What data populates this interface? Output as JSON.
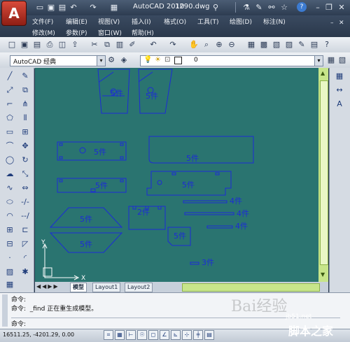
{
  "titlebar": {
    "title": "AutoCAD 2010",
    "file": "1290.dwg",
    "help_icon": "?"
  },
  "menu": [
    "文件(F)",
    "编辑(E)",
    "视图(V)",
    "插入(I)",
    "格式(O)",
    "工具(T)",
    "绘图(D)",
    "标注(N)",
    "修改(M)",
    "参数(P)",
    "窗口(W)",
    "帮助(H)"
  ],
  "toolbar": {
    "workspace": "AutoCAD 经典",
    "layer_value": "0"
  },
  "drawing": {
    "labels": [
      "5件",
      "5件",
      "5件",
      "5件",
      "5件",
      "5件",
      "5件",
      "5件",
      "2件",
      "5件",
      "4件",
      "4件",
      "4件",
      "3件",
      "5件"
    ]
  },
  "tabs": [
    "模型",
    "Layout1",
    "Layout2"
  ],
  "command": {
    "line1": "命令:",
    "line2": "命令:  _find 正在重生成模型。",
    "prompt": "命令:"
  },
  "status": {
    "coords": "16511.25, -4201.29, 0.00"
  },
  "axis": {
    "x": "X",
    "y": "Y"
  },
  "watermark": {
    "baidu": "Bai经验",
    "site": "jb51.net",
    "site_cn": "脚本之家"
  },
  "colors": {
    "canvas": "#2a7470",
    "lines": "#1c2bd6",
    "scroll": "#c7e58a"
  },
  "icons": [
    "app-menu-icon",
    "new-icon",
    "open-icon",
    "save-icon",
    "undo-icon",
    "redo-icon",
    "plot-icon",
    "search-icon",
    "help-icon"
  ]
}
